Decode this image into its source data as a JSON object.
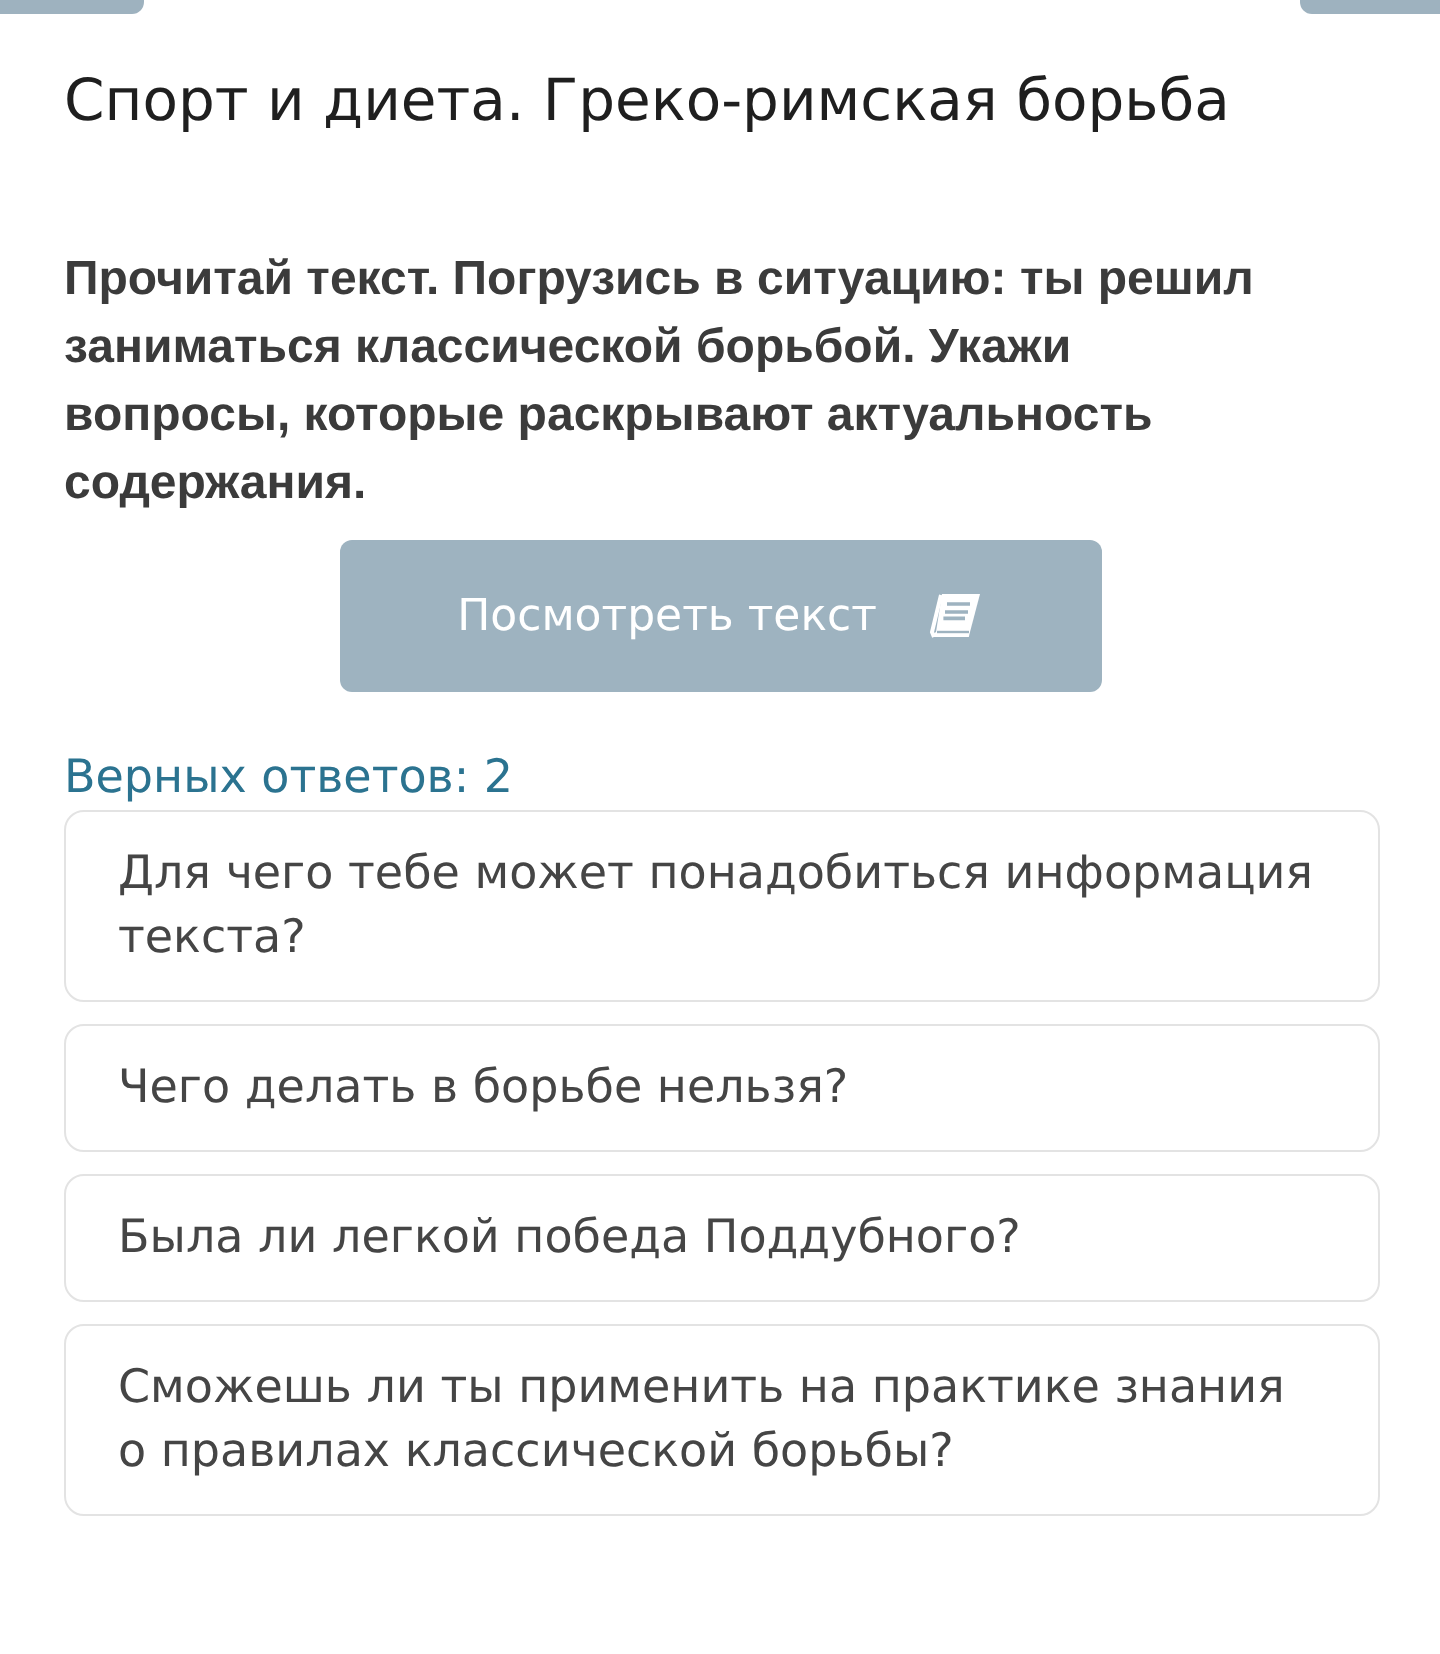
{
  "title": "Спорт и диета. Греко-римская борьба",
  "task": "Прочитай текст. Погрузись в ситуацию: ты решил заниматься классической борьбой. Укажи вопросы, которые раскрывают актуальность содержания.",
  "view_text_button": {
    "label": "Посмотреть текст"
  },
  "correct_answers_label": "Верных ответов: 2",
  "options": [
    {
      "text": "Для чего тебе может понадобиться информация текста?",
      "selected": false
    },
    {
      "text": "Чего делать в борьбе нельзя?",
      "selected": false
    },
    {
      "text": "Была ли легкой победа Поддубного?",
      "selected": false
    },
    {
      "text": "Сможешь ли ты применить на практике знания о правилах классической борьбы?",
      "selected": false
    }
  ]
}
